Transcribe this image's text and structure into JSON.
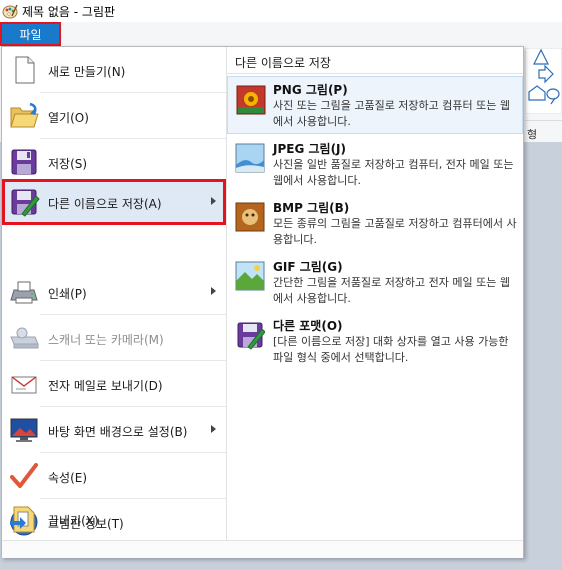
{
  "window": {
    "title": "제목 없음 - 그림판"
  },
  "file_tab": {
    "label": "파일"
  },
  "menu": {
    "items": [
      {
        "label": "새로 만들기(N)",
        "icon": "new-document-icon",
        "submenu": false,
        "enabled": true
      },
      {
        "label": "열기(O)",
        "icon": "open-folder-icon",
        "submenu": false,
        "enabled": true
      },
      {
        "label": "저장(S)",
        "icon": "save-disk-icon",
        "submenu": false,
        "enabled": true
      },
      {
        "label": "다른 이름으로 저장(A)",
        "icon": "save-as-icon",
        "submenu": true,
        "enabled": true,
        "selected": true
      },
      {
        "label": "인쇄(P)",
        "icon": "printer-icon",
        "submenu": true,
        "enabled": true
      },
      {
        "label": "스캐너 또는 카메라(M)",
        "icon": "scanner-icon",
        "submenu": false,
        "enabled": false
      },
      {
        "label": "전자 메일로 보내기(D)",
        "icon": "email-icon",
        "submenu": false,
        "enabled": true
      },
      {
        "label": "바탕 화면 배경으로 설정(B)",
        "icon": "desktop-background-icon",
        "submenu": true,
        "enabled": true
      },
      {
        "label": "속성(E)",
        "icon": "checkmark-icon",
        "submenu": false,
        "enabled": true
      },
      {
        "label": "그림판 정보(T)",
        "icon": "info-icon",
        "submenu": false,
        "enabled": true
      },
      {
        "label": "끝내기(X)",
        "icon": "exit-icon",
        "submenu": false,
        "enabled": true
      }
    ]
  },
  "submenu": {
    "header": "다른 이름으로 저장",
    "items": [
      {
        "title": "PNG 그림(P)",
        "desc": "사진 또는 그림을 고품질로 저장하고 컴퓨터 또는 웹에서 사용합니다.",
        "icon": "png-image-icon"
      },
      {
        "title": "JPEG 그림(J)",
        "desc": "사진을 일반 품질로 저장하고 컴퓨터, 전자 메일 또는 웹에서 사용합니다.",
        "icon": "jpeg-image-icon"
      },
      {
        "title": "BMP 그림(B)",
        "desc": "모든 종류의 그림을 고품질로 저장하고 컴퓨터에서 사용합니다.",
        "icon": "bmp-image-icon"
      },
      {
        "title": "GIF 그림(G)",
        "desc": "간단한 그림을 저품질로 저장하고 전자 메일 또는 웹에서 사용합니다.",
        "icon": "gif-image-icon"
      },
      {
        "title": "다른 포맷(O)",
        "desc": "[다른 이름으로 저장] 대화 상자를 열고 사용 가능한 파일 형식 중에서 선택합니다.",
        "icon": "other-format-icon"
      }
    ]
  },
  "ribbon": {
    "shape_group_label": "형"
  },
  "colors": {
    "file_tab": "#1979ca",
    "highlight_border": "#e3141f",
    "canvas": "#c8d0dc"
  }
}
